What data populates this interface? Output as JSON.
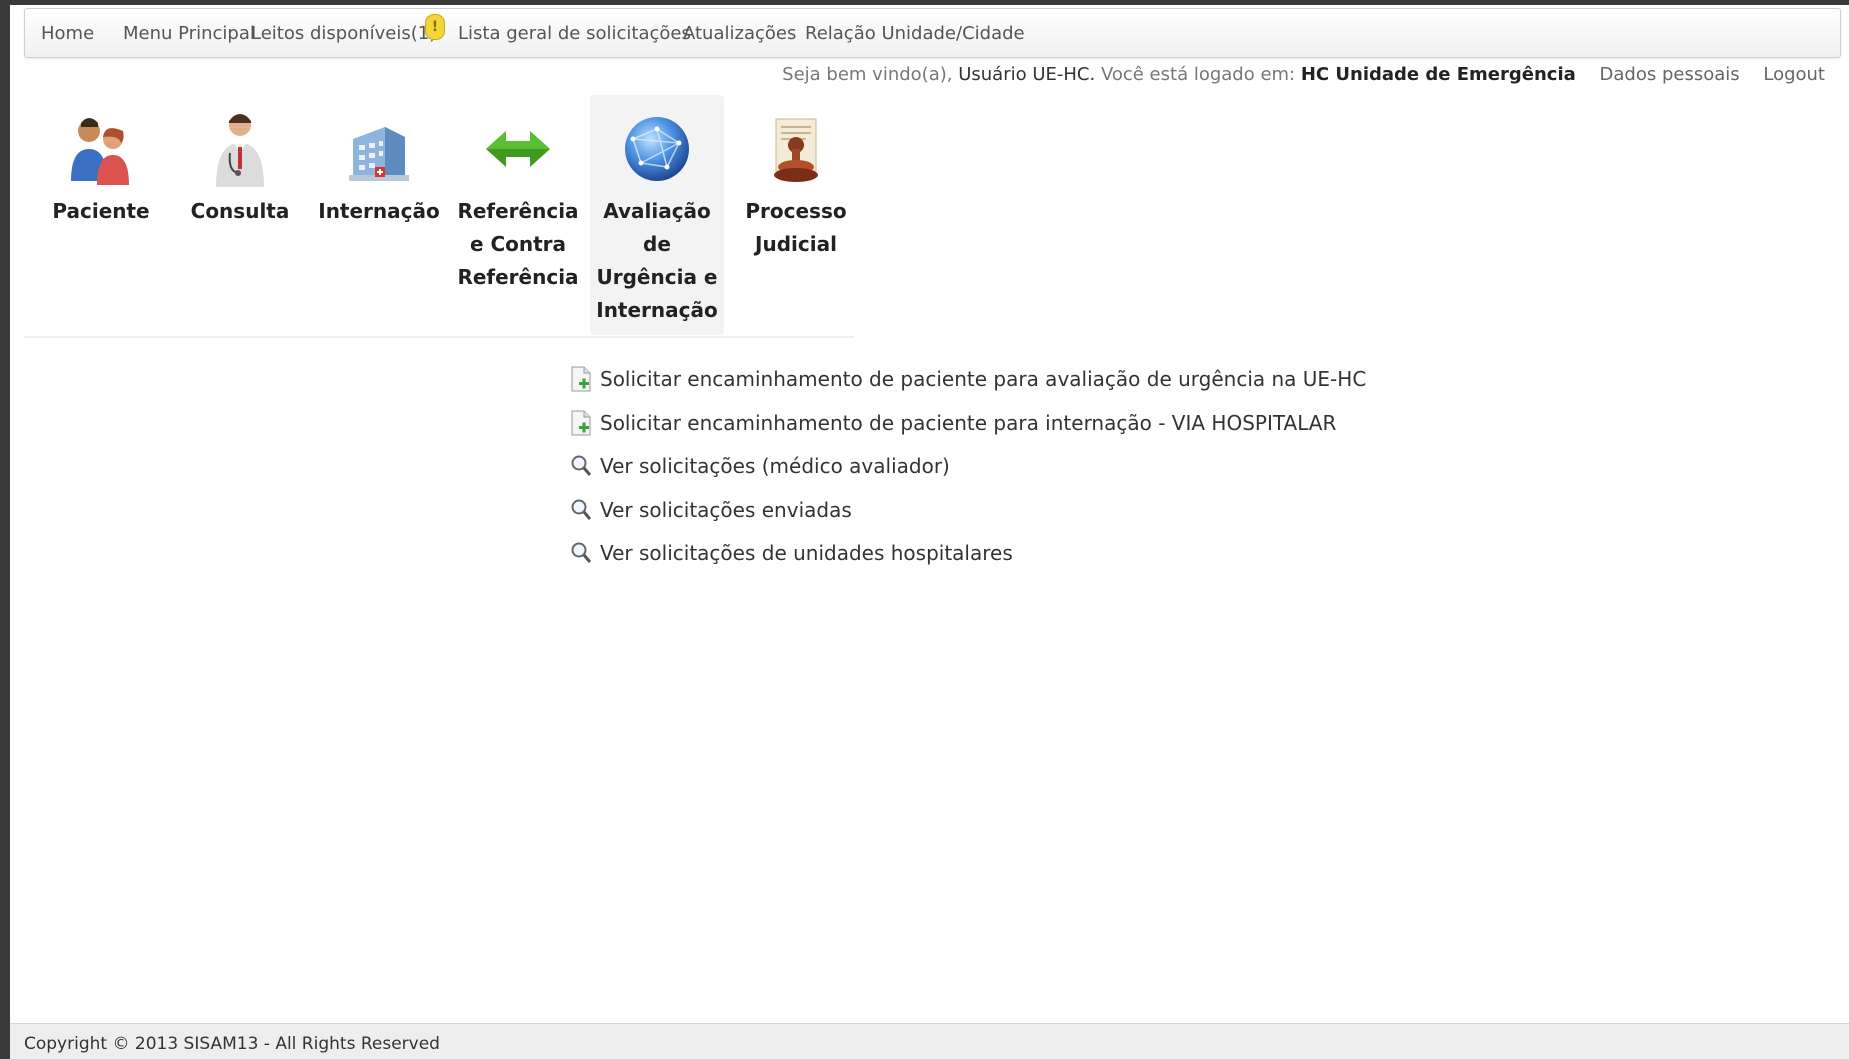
{
  "nav": {
    "home": "Home",
    "menu_principal": "Menu Principal",
    "leitos": "Leitos disponíveis(1)",
    "leitos_badge": "!",
    "lista_geral": "Lista geral de solicitações",
    "atualizacoes": "Atualizações",
    "relacao": "Relação Unidade/Cidade"
  },
  "welcome": {
    "prefix": "Seja bem vindo(a),",
    "user": "Usuário UE-HC.",
    "logged_in": "Você está logado em:",
    "unit": "HC Unidade de Emergência",
    "dados_pessoais": "Dados pessoais",
    "logout": "Logout"
  },
  "modules": [
    {
      "label": "Paciente",
      "icon": "patients-icon"
    },
    {
      "label": "Consulta",
      "icon": "doctor-icon"
    },
    {
      "label": "Internação",
      "icon": "hospital-icon"
    },
    {
      "label": "Referência e Contra Referência",
      "icon": "bidirectional-arrow-icon"
    },
    {
      "label": "Avaliação de Urgência e Internação",
      "icon": "globe-icon"
    },
    {
      "label": "Processo Judicial",
      "icon": "stamp-icon"
    }
  ],
  "actions": [
    {
      "label": "Solicitar encaminhamento de paciente para avaliação de urgência na UE-HC",
      "icon": "add-document-icon"
    },
    {
      "label": "Solicitar encaminhamento de paciente para internação - VIA HOSPITALAR",
      "icon": "add-document-icon"
    },
    {
      "label": "Ver solicitações (médico avaliador)",
      "icon": "magnifier-icon"
    },
    {
      "label": "Ver solicitações enviadas",
      "icon": "magnifier-icon"
    },
    {
      "label": "Ver solicitações de unidades hospitalares",
      "icon": "magnifier-icon"
    }
  ],
  "footer": {
    "copyright": "Copyright © 2013 SISAM13 - All Rights Reserved"
  },
  "colors": {
    "badge": "#f4d63a",
    "arrow_green": "#3f9a1f",
    "globe_blue": "#2f6fd6"
  }
}
